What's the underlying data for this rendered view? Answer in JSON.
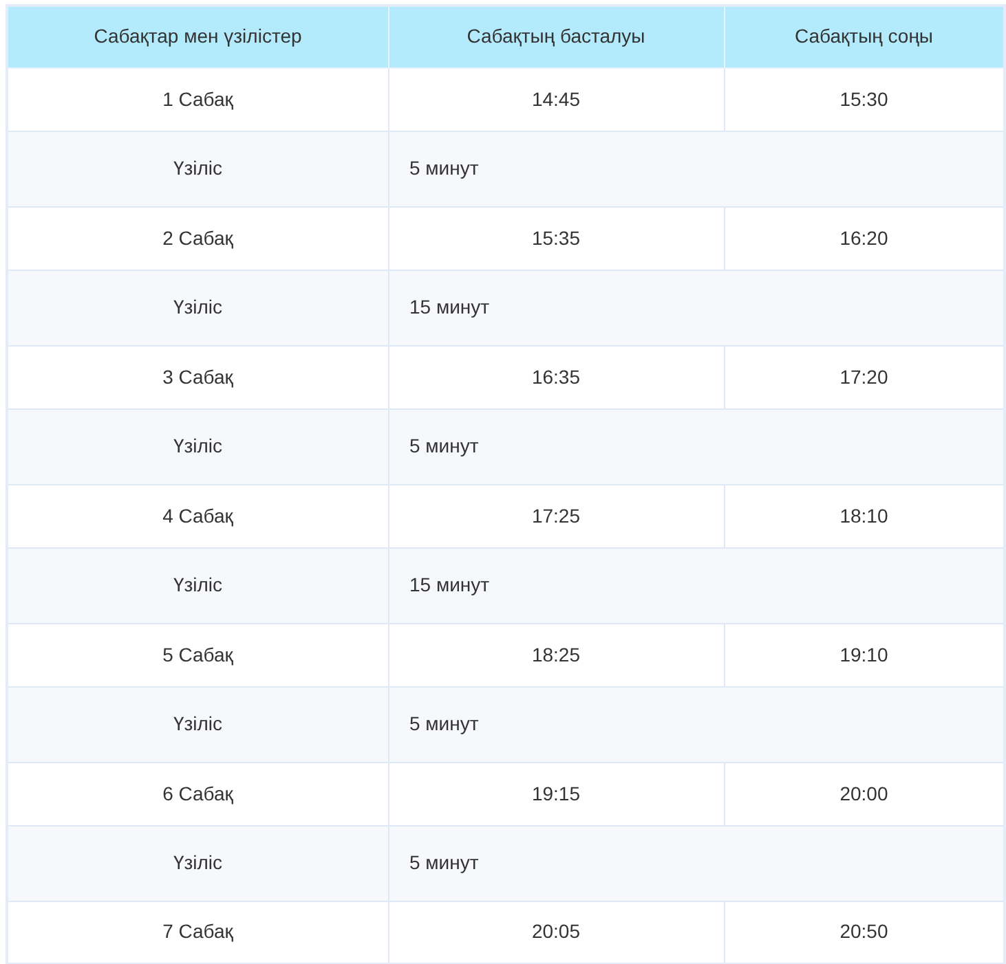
{
  "table": {
    "columns": [
      "Сабақтар мен үзілістер",
      "Сабақтың басталуы",
      "Сабақтың соңы"
    ],
    "rows": [
      {
        "kind": "lesson",
        "cells": [
          "1 Сабақ",
          "14:45",
          "15:30"
        ]
      },
      {
        "kind": "break",
        "cells": [
          "Үзіліс",
          {
            "text": "5 минут",
            "colspan": 2
          }
        ]
      },
      {
        "kind": "lesson",
        "cells": [
          "2 Сабақ",
          "15:35",
          "16:20"
        ]
      },
      {
        "kind": "break",
        "cells": [
          "Үзіліс",
          {
            "text": "15 минут",
            "colspan": 2
          }
        ]
      },
      {
        "kind": "lesson",
        "cells": [
          "3 Сабақ",
          "16:35",
          "17:20"
        ]
      },
      {
        "kind": "break",
        "cells": [
          "Үзіліс",
          {
            "text": "5 минут",
            "colspan": 2
          }
        ]
      },
      {
        "kind": "lesson",
        "cells": [
          "4 Сабақ",
          "17:25",
          "18:10"
        ]
      },
      {
        "kind": "break",
        "cells": [
          "Үзіліс",
          {
            "text": "15 минут",
            "colspan": 2
          }
        ]
      },
      {
        "kind": "lesson",
        "cells": [
          "5 Сабақ",
          "18:25",
          "19:10"
        ]
      },
      {
        "kind": "break",
        "cells": [
          "Үзіліс",
          {
            "text": "5 минут",
            "colspan": 2
          }
        ]
      },
      {
        "kind": "lesson",
        "cells": [
          "6 Сабақ",
          "19:15",
          "20:00"
        ]
      },
      {
        "kind": "break",
        "cells": [
          "Үзіліс",
          {
            "text": "5 минут",
            "colspan": 2
          }
        ]
      },
      {
        "kind": "lesson",
        "cells": [
          "7 Сабақ",
          "20:05",
          "20:50"
        ]
      }
    ]
  }
}
